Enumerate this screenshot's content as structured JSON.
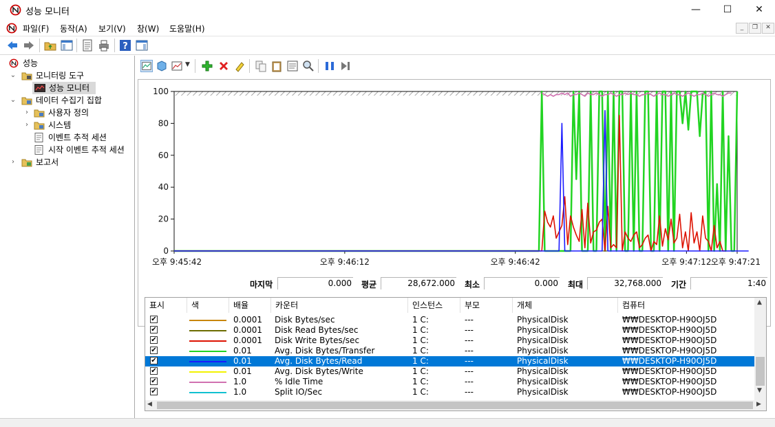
{
  "window": {
    "title": "성능 모니터"
  },
  "menu": {
    "items": [
      "파일(F)",
      "동작(A)",
      "보기(V)",
      "창(W)",
      "도움말(H)"
    ]
  },
  "tree": {
    "items": [
      {
        "label": "성능",
        "arrow": "",
        "level": 0,
        "icon": "perf-root-icon"
      },
      {
        "label": "모니터링 도구",
        "arrow": "⌄",
        "level": 1,
        "icon": "folder-icon"
      },
      {
        "label": "성능 모니터",
        "arrow": "",
        "level": 2,
        "icon": "monitor-chart-icon",
        "selected": true
      },
      {
        "label": "데이터 수집기 집합",
        "arrow": "⌄",
        "level": 1,
        "icon": "folder-icon"
      },
      {
        "label": "사용자 정의",
        "arrow": "›",
        "level": 2,
        "icon": "collector-set-icon"
      },
      {
        "label": "시스템",
        "arrow": "›",
        "level": 2,
        "icon": "collector-set-icon"
      },
      {
        "label": "이벤트 추적 세션",
        "arrow": "",
        "level": 2,
        "icon": "trace-session-icon"
      },
      {
        "label": "시작 이벤트 추적 세션",
        "arrow": "",
        "level": 2,
        "icon": "trace-session-icon"
      },
      {
        "label": "보고서",
        "arrow": "›",
        "level": 1,
        "icon": "folder-icon"
      }
    ]
  },
  "stats": {
    "last_label": "마지막",
    "last_value": "0.000",
    "avg_label": "평균",
    "avg_value": "28,672.000",
    "min_label": "최소",
    "min_value": "0.000",
    "max_label": "최대",
    "max_value": "32,768.000",
    "duration_label": "기간",
    "duration_value": "1:40"
  },
  "table": {
    "headers": [
      "표시",
      "색",
      "배율",
      "카운터",
      "인스턴스",
      "부모",
      "개체",
      "컴퓨터"
    ],
    "rows": [
      {
        "scale": "0.0001",
        "counter": "Disk Bytes/sec",
        "instance": "1 C:",
        "parent": "---",
        "object": "PhysicalDisk",
        "computer": "₩₩DESKTOP-H90OJ5D",
        "color": "#c8860a",
        "selected": false
      },
      {
        "scale": "0.0001",
        "counter": "Disk Read Bytes/sec",
        "instance": "1 C:",
        "parent": "---",
        "object": "PhysicalDisk",
        "computer": "₩₩DESKTOP-H90OJ5D",
        "color": "#6b6b00",
        "selected": false
      },
      {
        "scale": "0.0001",
        "counter": "Disk Write Bytes/sec",
        "instance": "1 C:",
        "parent": "---",
        "object": "PhysicalDisk",
        "computer": "₩₩DESKTOP-H90OJ5D",
        "color": "#dd1100",
        "selected": false
      },
      {
        "scale": "0.01",
        "counter": "Avg. Disk Bytes/Transfer",
        "instance": "1 C:",
        "parent": "---",
        "object": "PhysicalDisk",
        "computer": "₩₩DESKTOP-H90OJ5D",
        "color": "#22d422",
        "selected": false
      },
      {
        "scale": "0.01",
        "counter": "Avg. Disk Bytes/Read",
        "instance": "1 C:",
        "parent": "---",
        "object": "PhysicalDisk",
        "computer": "₩₩DESKTOP-H90OJ5D",
        "color": "#1a1aff",
        "selected": true
      },
      {
        "scale": "0.01",
        "counter": "Avg. Disk Bytes/Write",
        "instance": "1 C:",
        "parent": "---",
        "object": "PhysicalDisk",
        "computer": "₩₩DESKTOP-H90OJ5D",
        "color": "#f2f200",
        "selected": false
      },
      {
        "scale": "1.0",
        "counter": "% Idle Time",
        "instance": "1 C:",
        "parent": "---",
        "object": "PhysicalDisk",
        "computer": "₩₩DESKTOP-H90OJ5D",
        "color": "#d070b0",
        "selected": false
      },
      {
        "scale": "1.0",
        "counter": "Split IO/Sec",
        "instance": "1 C:",
        "parent": "---",
        "object": "PhysicalDisk",
        "computer": "₩₩DESKTOP-H90OJ5D",
        "color": "#10c0d0",
        "selected": false
      }
    ]
  },
  "chart_data": {
    "type": "line",
    "ylim": [
      0,
      100
    ],
    "yticks": [
      "100",
      "80",
      "60",
      "40",
      "20",
      "0"
    ],
    "xtick_labels": [
      "오후 9:45:42",
      "오후 9:46:12",
      "오후 9:46:42",
      "오후 9:47:12",
      "오후 9:47:21"
    ],
    "series": [
      {
        "name": "Avg. Disk Bytes/Transfer",
        "color": "#22d422",
        "values": [
          0,
          0,
          0,
          0,
          0,
          0,
          0,
          0,
          0,
          0,
          0,
          0,
          0,
          0,
          0,
          0,
          0,
          0,
          0,
          0,
          0,
          0,
          0,
          0,
          0,
          0,
          0,
          0,
          0,
          0,
          0,
          0,
          0,
          0,
          0,
          0,
          0,
          0,
          0,
          0,
          0,
          0,
          0,
          0,
          0,
          0,
          0,
          0,
          0,
          0,
          0,
          0,
          0,
          0,
          0,
          0,
          0,
          0,
          0,
          0,
          0,
          0,
          0,
          0,
          0,
          0,
          0,
          0,
          0,
          0,
          0,
          0,
          0,
          0,
          0,
          0,
          0,
          0,
          0,
          0,
          0,
          0,
          0,
          0,
          0,
          0,
          0,
          0,
          0,
          0,
          0,
          0,
          0,
          0,
          0,
          0,
          0,
          0,
          0,
          0,
          0,
          0,
          0,
          0,
          0,
          0,
          0,
          0,
          0,
          0,
          0,
          0,
          0,
          0,
          0,
          0,
          0,
          0,
          0,
          0,
          0,
          0,
          0,
          0,
          0,
          0,
          0,
          0,
          100,
          0,
          0,
          0,
          0,
          0,
          0,
          0,
          0,
          0,
          0,
          100,
          45,
          100,
          0,
          0,
          0,
          100,
          0,
          0,
          100,
          100,
          0,
          100,
          0,
          100,
          0,
          100,
          100,
          0,
          0,
          100,
          0,
          100,
          0,
          0,
          100,
          100,
          0,
          0,
          100,
          0,
          100,
          100,
          0,
          100,
          0,
          100,
          100,
          80,
          100,
          76,
          100,
          100,
          100,
          72,
          98,
          100,
          0,
          100,
          0,
          42,
          0,
          100,
          0,
          72,
          0,
          0,
          100
        ]
      },
      {
        "name": "Disk Write Bytes/sec",
        "color": "#dd1100",
        "values": [
          0,
          0,
          0,
          0,
          0,
          0,
          0,
          0,
          0,
          0,
          0,
          0,
          0,
          0,
          0,
          0,
          0,
          0,
          0,
          0,
          0,
          0,
          0,
          0,
          0,
          0,
          0,
          0,
          0,
          0,
          0,
          0,
          0,
          0,
          0,
          0,
          0,
          0,
          0,
          0,
          0,
          0,
          0,
          0,
          0,
          0,
          0,
          0,
          0,
          0,
          0,
          0,
          0,
          0,
          0,
          0,
          0,
          0,
          0,
          0,
          0,
          0,
          0,
          0,
          0,
          0,
          0,
          0,
          0,
          0,
          0,
          0,
          0,
          0,
          0,
          0,
          0,
          0,
          0,
          0,
          0,
          0,
          0,
          0,
          0,
          0,
          0,
          0,
          0,
          0,
          0,
          0,
          0,
          0,
          0,
          0,
          0,
          0,
          0,
          0,
          0,
          0,
          0,
          0,
          0,
          0,
          0,
          0,
          0,
          0,
          0,
          0,
          0,
          0,
          0,
          0,
          0,
          0,
          0,
          0,
          0,
          0,
          0,
          0,
          0,
          0,
          0,
          0,
          0,
          25,
          18,
          15,
          22,
          8,
          12,
          16,
          34,
          4,
          22,
          15,
          10,
          6,
          26,
          2,
          30,
          5,
          12,
          13,
          18,
          20,
          0,
          28,
          2,
          4,
          2,
          85,
          0,
          12,
          8,
          6,
          10,
          12,
          2,
          4,
          8,
          10,
          0,
          6,
          4,
          22,
          3,
          14,
          7,
          20,
          5,
          8,
          23,
          2,
          12,
          0,
          24,
          5,
          12,
          0,
          22,
          8,
          6,
          0,
          16,
          2,
          6,
          0,
          0
        ]
      },
      {
        "name": "Avg. Disk Bytes/Read",
        "color": "#1a1aff",
        "values": [
          0,
          0,
          0,
          0,
          0,
          0,
          0,
          0,
          0,
          0,
          0,
          0,
          0,
          0,
          0,
          0,
          0,
          0,
          0,
          0,
          0,
          0,
          0,
          0,
          0,
          0,
          0,
          0,
          0,
          0,
          0,
          0,
          0,
          0,
          0,
          0,
          0,
          0,
          0,
          0,
          0,
          0,
          0,
          0,
          0,
          0,
          0,
          0,
          0,
          0,
          0,
          0,
          0,
          0,
          0,
          0,
          0,
          0,
          0,
          0,
          0,
          0,
          0,
          0,
          0,
          0,
          0,
          0,
          0,
          0,
          0,
          0,
          0,
          0,
          0,
          0,
          0,
          0,
          0,
          0,
          0,
          0,
          0,
          0,
          0,
          0,
          0,
          0,
          0,
          0,
          0,
          0,
          0,
          0,
          0,
          0,
          0,
          0,
          0,
          0,
          0,
          0,
          0,
          0,
          0,
          0,
          0,
          0,
          0,
          0,
          0,
          0,
          0,
          0,
          0,
          0,
          0,
          0,
          0,
          0,
          0,
          0,
          0,
          0,
          0,
          0,
          0,
          0,
          0,
          0,
          0,
          0,
          0,
          0,
          0,
          80,
          0,
          0,
          0,
          0,
          0,
          0,
          0,
          0,
          0,
          0,
          0,
          0,
          0,
          0,
          88,
          0,
          0,
          0,
          0,
          0,
          0,
          0,
          0,
          0,
          0,
          0,
          0,
          0,
          0,
          0,
          0,
          0,
          0,
          0,
          0,
          0,
          0,
          0,
          0,
          0,
          0,
          0,
          0,
          0,
          0,
          0,
          0,
          0,
          0,
          0,
          0,
          0,
          0,
          0,
          0,
          0,
          0,
          0,
          0,
          0,
          0,
          0,
          0,
          0,
          0
        ]
      },
      {
        "name": "% Idle Time",
        "color": "#d070b0",
        "values": [
          null,
          null,
          null,
          null,
          null,
          null,
          null,
          null,
          null,
          null,
          null,
          null,
          null,
          null,
          null,
          null,
          null,
          null,
          null,
          null,
          null,
          null,
          null,
          null,
          null,
          null,
          null,
          null,
          null,
          null,
          null,
          null,
          null,
          null,
          null,
          null,
          null,
          null,
          null,
          null,
          null,
          null,
          null,
          null,
          null,
          null,
          null,
          null,
          null,
          null,
          null,
          null,
          null,
          null,
          null,
          null,
          null,
          null,
          null,
          null,
          null,
          null,
          null,
          null,
          null,
          null,
          null,
          null,
          null,
          null,
          null,
          null,
          null,
          null,
          null,
          null,
          null,
          null,
          null,
          null,
          null,
          null,
          null,
          null,
          null,
          null,
          null,
          null,
          null,
          null,
          null,
          null,
          null,
          null,
          null,
          null,
          null,
          null,
          null,
          null,
          null,
          null,
          null,
          null,
          null,
          null,
          null,
          null,
          null,
          null,
          null,
          null,
          null,
          null,
          null,
          null,
          null,
          null,
          null,
          null,
          null,
          null,
          null,
          null,
          null,
          null,
          null,
          null,
          99,
          98,
          97,
          98,
          97,
          98,
          98,
          99,
          98,
          99,
          97,
          98,
          98,
          99,
          98,
          97,
          99,
          98,
          98,
          99,
          98,
          97,
          98,
          98,
          99,
          98,
          97,
          98,
          98,
          99,
          98,
          99,
          98,
          98,
          97,
          98,
          98,
          99,
          98,
          97,
          98,
          99,
          98,
          98,
          97,
          98,
          99,
          98,
          98,
          97,
          98,
          99,
          98,
          97,
          98,
          98,
          99,
          98,
          97,
          98,
          99,
          98,
          98,
          97,
          98,
          99,
          99
        ]
      }
    ]
  }
}
